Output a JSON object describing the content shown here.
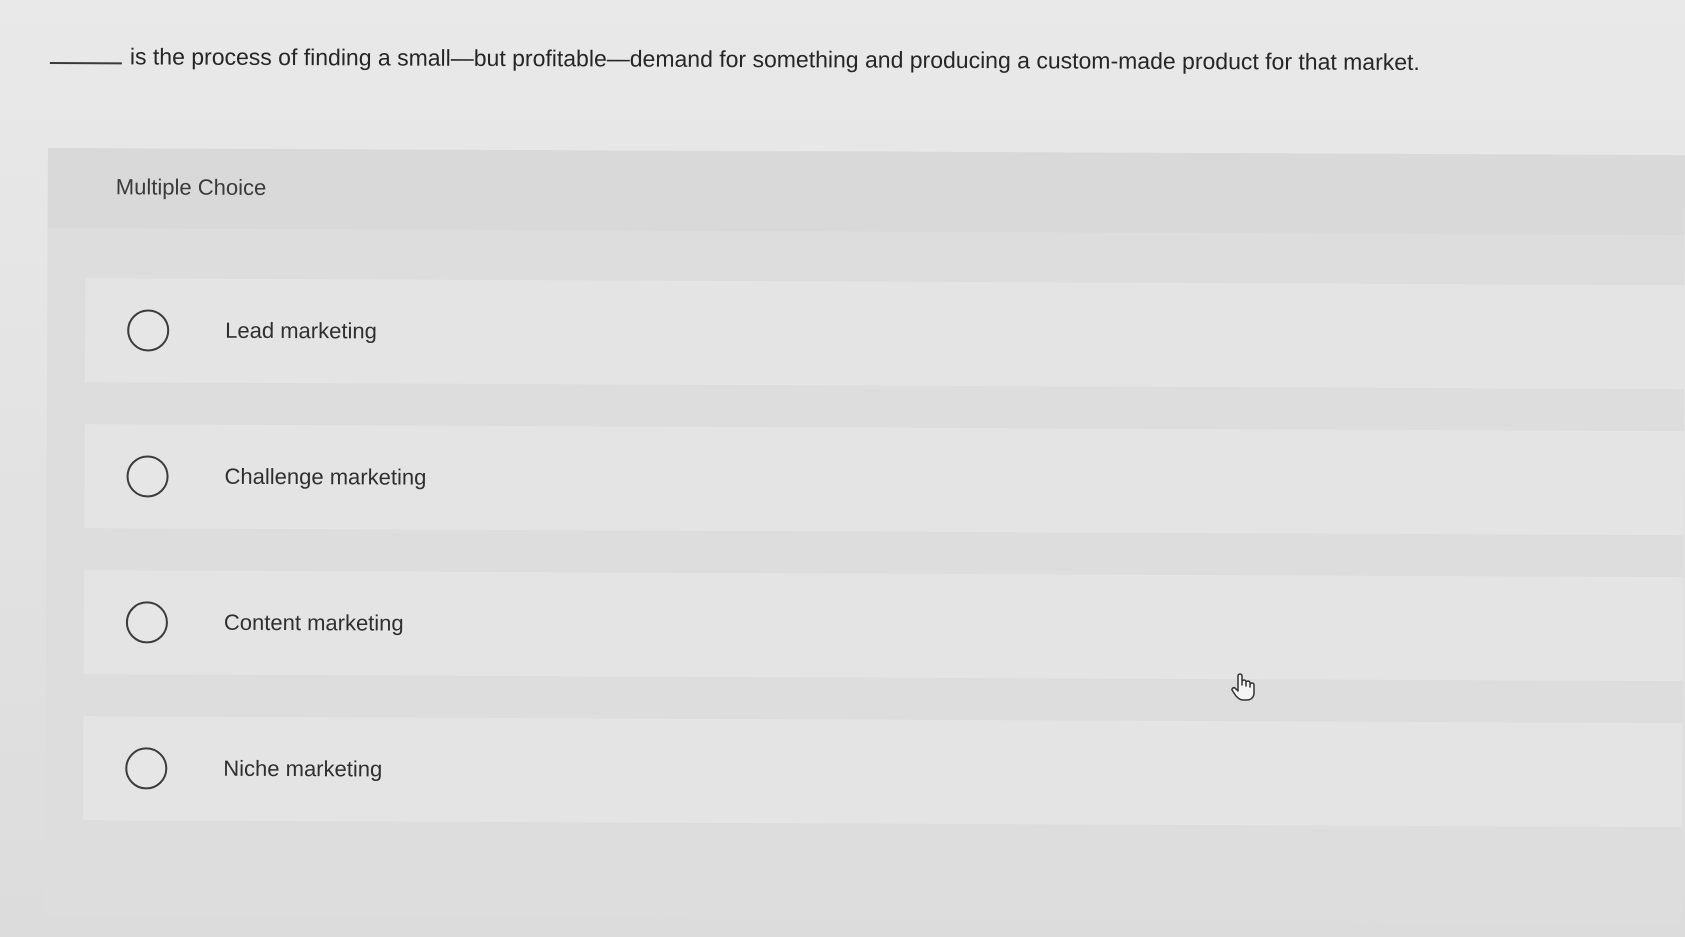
{
  "question": {
    "text": "is the process of finding a small—but profitable—demand for something and producing a custom-made product for that market."
  },
  "panel": {
    "title": "Multiple Choice"
  },
  "options": [
    {
      "label": "Lead marketing",
      "selected": false
    },
    {
      "label": "Challenge marketing",
      "selected": false
    },
    {
      "label": "Content marketing",
      "selected": false
    },
    {
      "label": "Niche marketing",
      "selected": false
    }
  ],
  "cursor": {
    "icon": "hand-pointer-icon"
  }
}
